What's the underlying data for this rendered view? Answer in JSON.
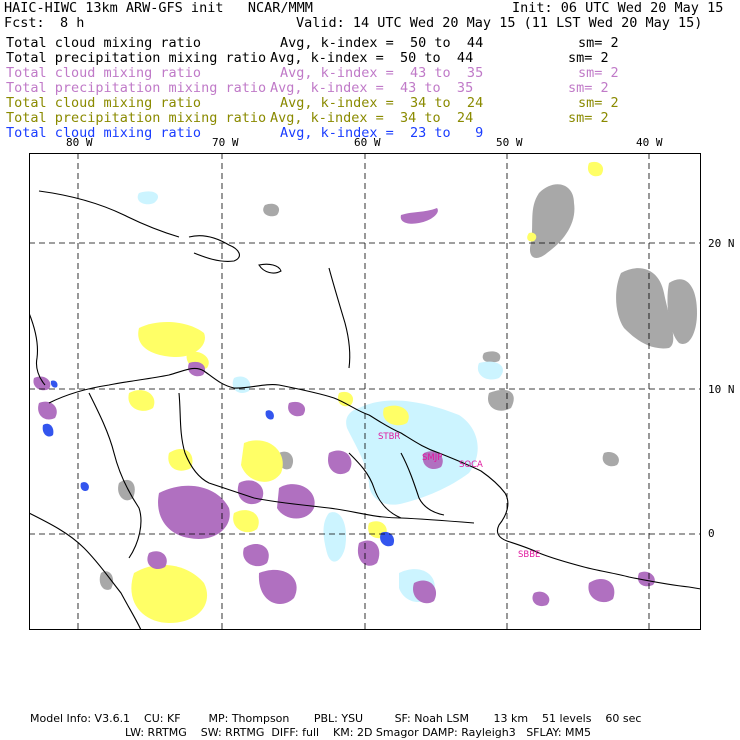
{
  "header": {
    "title": "HAIC-HIWC 13km ARW-GFS init   NCAR/MMM",
    "init": "Init: 06 UTC Wed 20 May 15",
    "fcst_label": "Fcst:",
    "fcst_value": "8 h",
    "valid": "Valid: 14 UTC Wed 20 May 15 (11 LST Wed 20 May 15)",
    "fields": [
      {
        "name": "Total cloud mixing ratio",
        "avg": "Avg, k-index =  50 to  44",
        "sm": "sm= 2",
        "color": "#000000"
      },
      {
        "name": "Total precipitation mixing ratio",
        "avg": "Avg, k-index =  50 to  44",
        "sm": "sm= 2",
        "color": "#000000"
      },
      {
        "name": "Total cloud mixing ratio",
        "avg": "Avg, k-index =  43 to  35",
        "sm": "sm= 2",
        "color": "#c07ac8"
      },
      {
        "name": "Total precipitation mixing ratio",
        "avg": "Avg, k-index =  43 to  35",
        "sm": "sm= 2",
        "color": "#c07ac8"
      },
      {
        "name": "Total cloud mixing ratio",
        "avg": "Avg, k-index =  34 to  24",
        "sm": "sm= 2",
        "color": "#8a8a00"
      },
      {
        "name": "Total precipitation mixing ratio",
        "avg": "Avg, k-index =  34 to  24",
        "sm": "sm= 2",
        "color": "#8a8a00"
      },
      {
        "name": "Total cloud mixing ratio",
        "avg": "Avg, k-index =  23 to   9",
        "sm": "",
        "color": "#1a3cff"
      }
    ]
  },
  "map": {
    "lon_labels": [
      "80 W",
      "70 W",
      "60 W",
      "50 W",
      "40 W"
    ],
    "lat_labels": [
      "20 N",
      "10 N",
      "0"
    ],
    "stations": [
      "STBR",
      "SMJP",
      "SOCA",
      "SBBE"
    ],
    "colors": {
      "gray": "#a8a8a8",
      "yellow": "#ffff66",
      "purple": "#b070c0",
      "cyan": "#ccf4ff",
      "blue": "#3355ee",
      "station": "#e0189e"
    }
  },
  "footer": {
    "line1": "Model Info: V3.6.1    CU: KF        MP: Thompson       PBL: YSU         SF: Noah LSM       13 km    51 levels    60 sec",
    "line2": "LW: RRTMG    SW: RRTMG  DIFF: full    KM: 2D Smagor DAMP: Rayleigh3   SFLAY: MM5"
  }
}
